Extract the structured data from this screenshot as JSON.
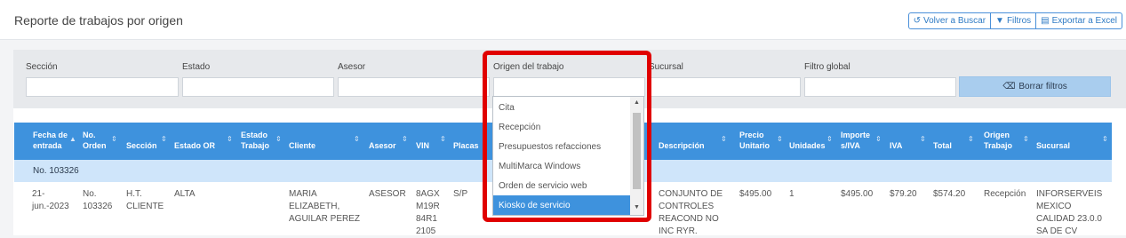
{
  "page": {
    "title": "Reporte de trabajos por origen"
  },
  "toolbar": {
    "back_label": "Volver a Buscar",
    "filters_label": "Filtros",
    "export_label": "Exportar a Excel"
  },
  "filters": {
    "seccion_label": "Sección",
    "estado_label": "Estado",
    "asesor_label": "Asesor",
    "origen_label": "Origen del trabajo",
    "sucursal_label": "Sucursal",
    "global_label": "Filtro global",
    "clear_label": "Borrar filtros"
  },
  "origen_dropdown": {
    "options": [
      "Cita",
      "Recepción",
      "Presupuestos refacciones",
      "MultiMarca Windows",
      "Orden de servicio web",
      "Kiosko de servicio"
    ],
    "selected": "Kiosko de servicio"
  },
  "table": {
    "columns": [
      "Fecha de entrada",
      "No. Orden",
      "Sección",
      "Estado OR",
      "Estado Trabajo",
      "Cliente",
      "Asesor",
      "VIN",
      "Placas",
      "Descripción",
      "Precio Unitario",
      "Unidades",
      "Importe s/IVA",
      "IVA",
      "Total",
      "Origen Trabajo",
      "Sucursal"
    ],
    "group": "No. 103326",
    "rows": [
      {
        "fecha": "21-jun.-2023",
        "orden": "No. 103326",
        "seccion": "H.T. CLIENTE",
        "estado_or": "ALTA",
        "estado_trabajo": "",
        "cliente": "MARIA ELIZABETH, AGUILAR PEREZ",
        "asesor": "ASESOR",
        "vin": "8AGX M19R 84R1 2105",
        "placas": "S/P",
        "descripcion": "CONJUNTO DE CONTROLES REACOND NO INC RYR.",
        "precio": "$495.00",
        "unidades": "1",
        "importe": "$495.00",
        "iva": "$79.20",
        "total": "$574.20",
        "origen": "Recepción",
        "sucursal": "INFORSERVEIS MEXICO CALIDAD 23.0.0 SA DE CV"
      }
    ]
  },
  "colors": {
    "accent": "#3e92dd",
    "highlight": "#e00000",
    "group_row": "#cfe5fa"
  }
}
